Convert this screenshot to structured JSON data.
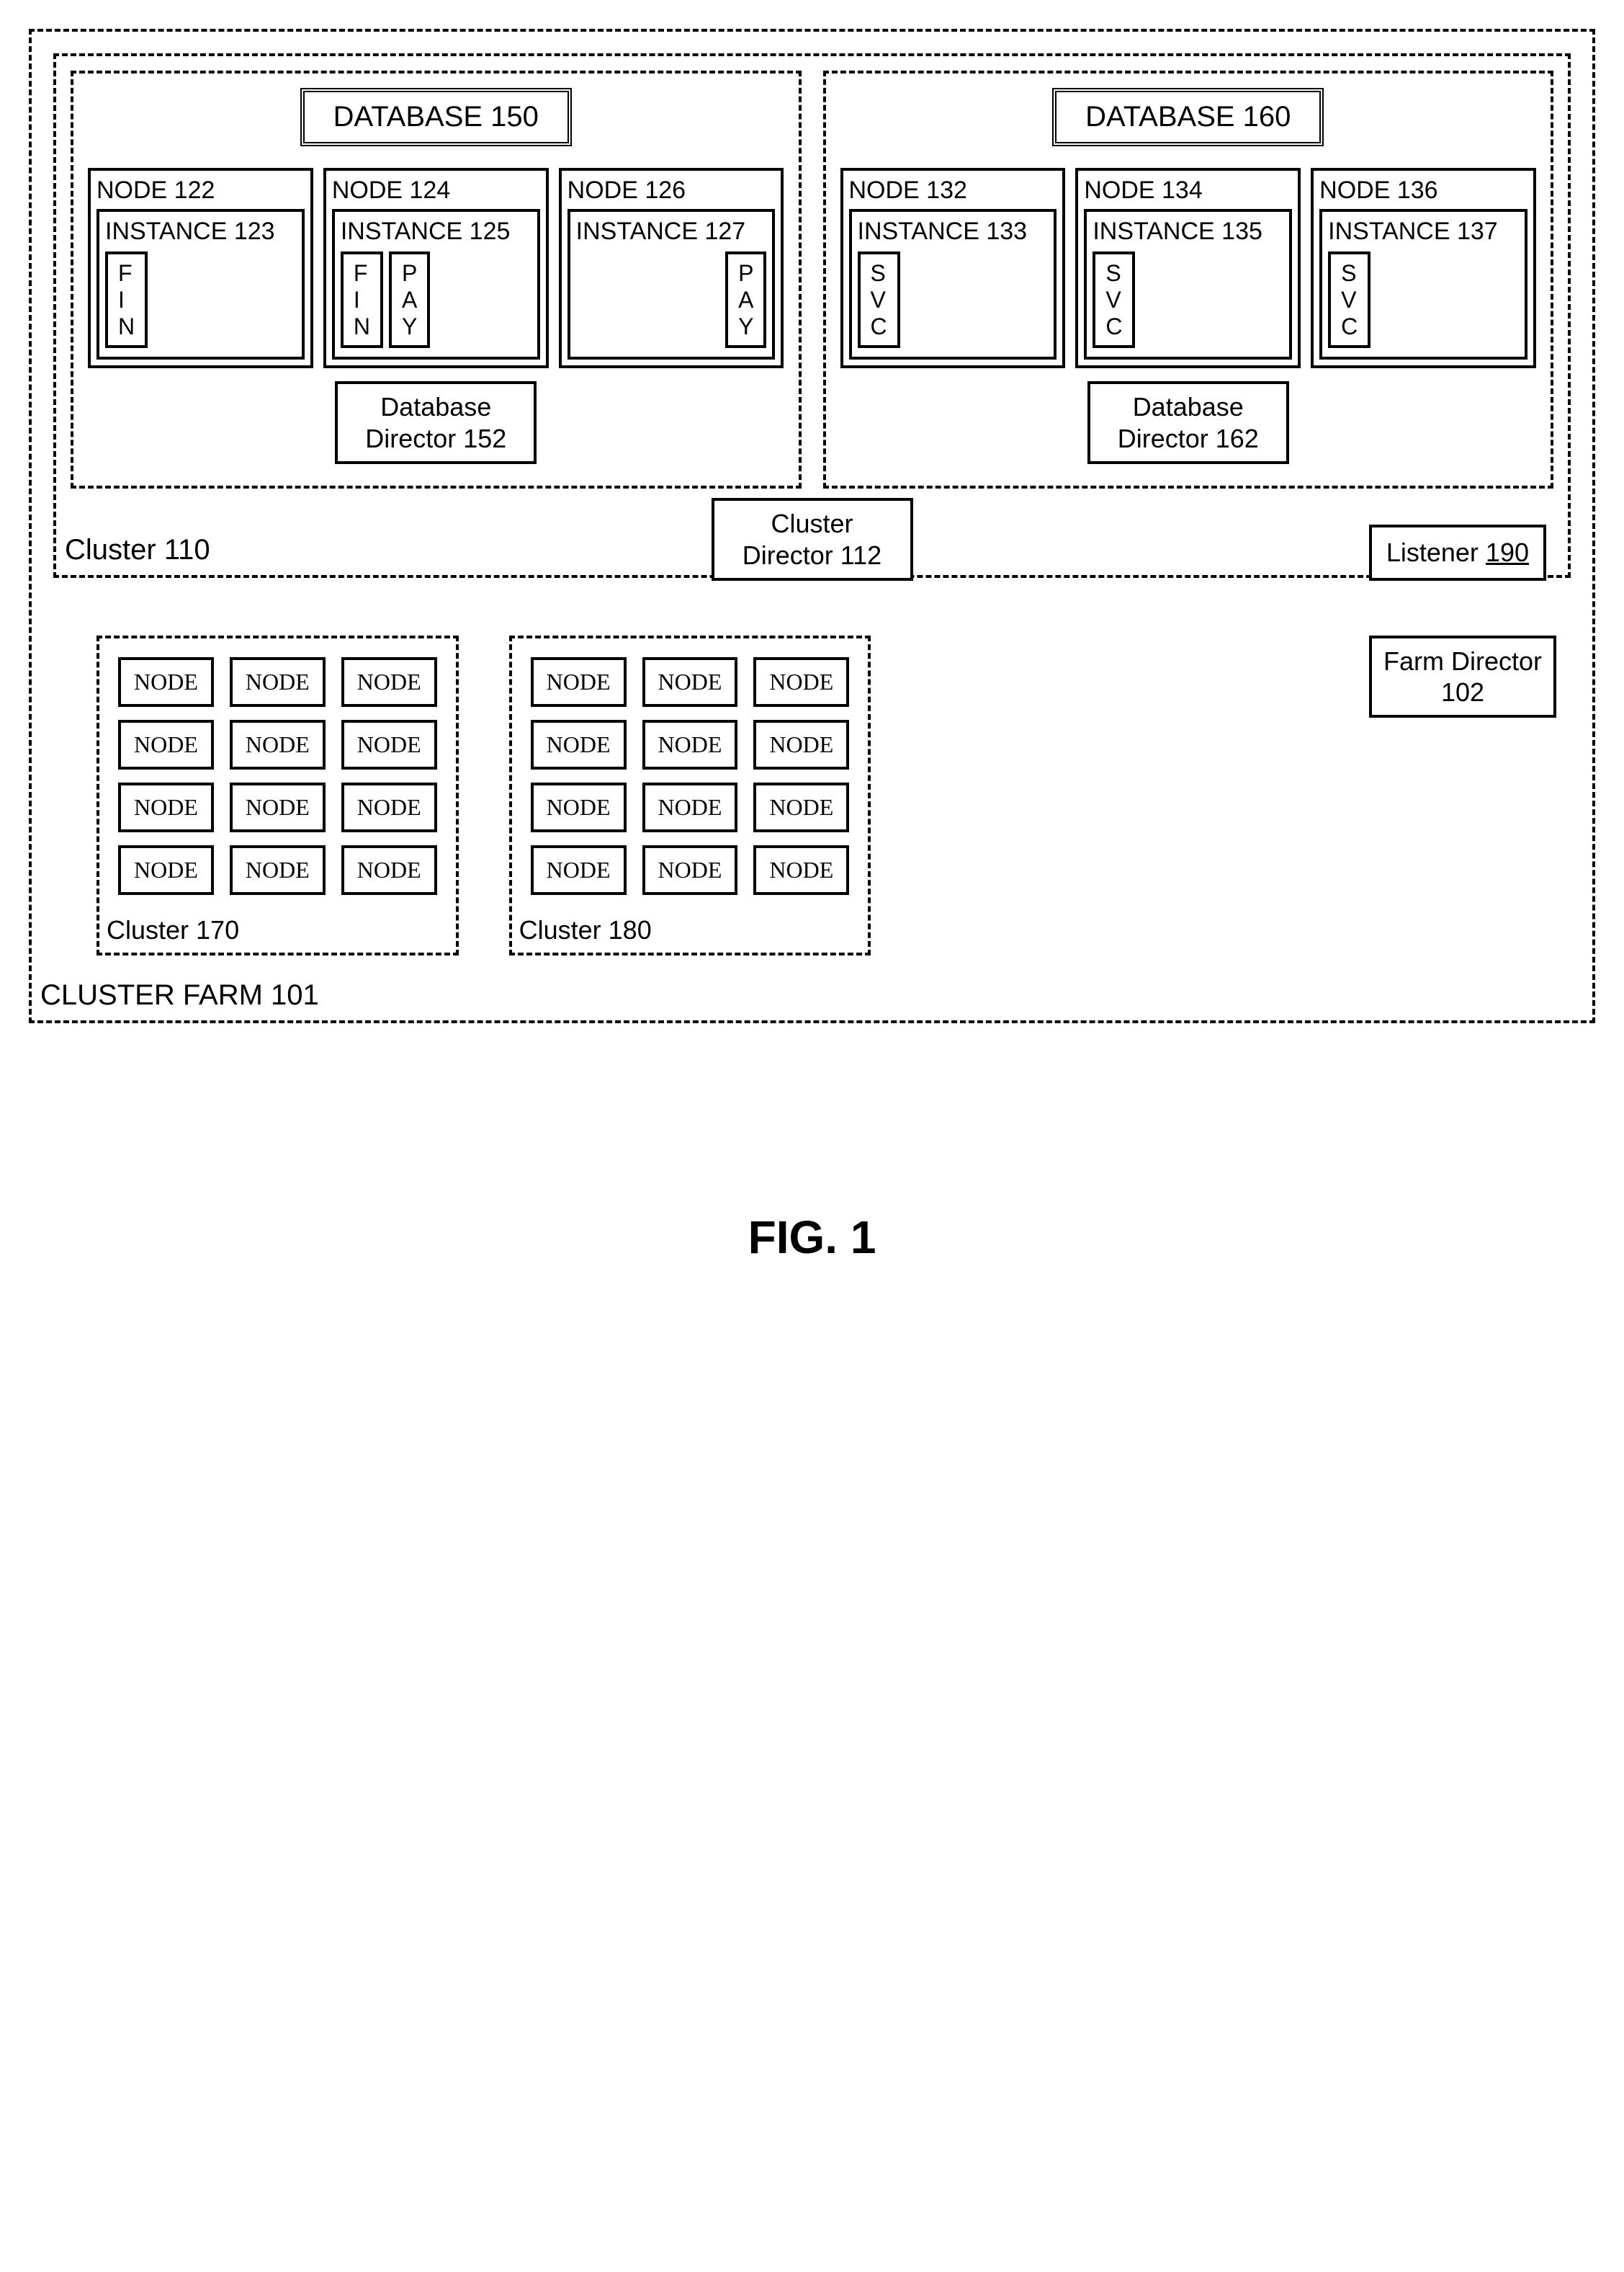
{
  "figure_caption": "FIG. 1",
  "farm": {
    "label": "CLUSTER FARM 101",
    "director": "Farm Director 102"
  },
  "cluster110": {
    "label": "Cluster 110",
    "cluster_director": "Cluster Director 112",
    "listener_text": "Listener ",
    "listener_num": "190",
    "db150": {
      "title": "DATABASE  150",
      "director": "Database Director 152",
      "nodes": [
        {
          "node": "NODE 122",
          "instance": "INSTANCE 123",
          "svcs": [
            "F\nI\nN"
          ],
          "align": "left"
        },
        {
          "node": "NODE 124",
          "instance": "INSTANCE 125",
          "svcs": [
            "F\nI\nN",
            "P\nA\nY"
          ],
          "align": "left"
        },
        {
          "node": "NODE 126",
          "instance": "INSTANCE 127",
          "svcs": [
            "P\nA\nY"
          ],
          "align": "right"
        }
      ]
    },
    "db160": {
      "title": "DATABASE  160",
      "director": "Database Director 162",
      "nodes": [
        {
          "node": "NODE 132",
          "instance": "INSTANCE 133",
          "svcs": [
            "S\nV\nC"
          ],
          "align": "left"
        },
        {
          "node": "NODE 134",
          "instance": "INSTANCE 135",
          "svcs": [
            "S\nV\nC"
          ],
          "align": "left"
        },
        {
          "node": "NODE 136",
          "instance": "INSTANCE 137",
          "svcs": [
            "S\nV\nC"
          ],
          "align": "left"
        }
      ]
    }
  },
  "cluster170": {
    "label": "Cluster 170",
    "node_label": "NODE",
    "rows": 4,
    "cols": 3
  },
  "cluster180": {
    "label": "Cluster 180",
    "node_label": "NODE",
    "rows": 4,
    "cols": 3
  }
}
